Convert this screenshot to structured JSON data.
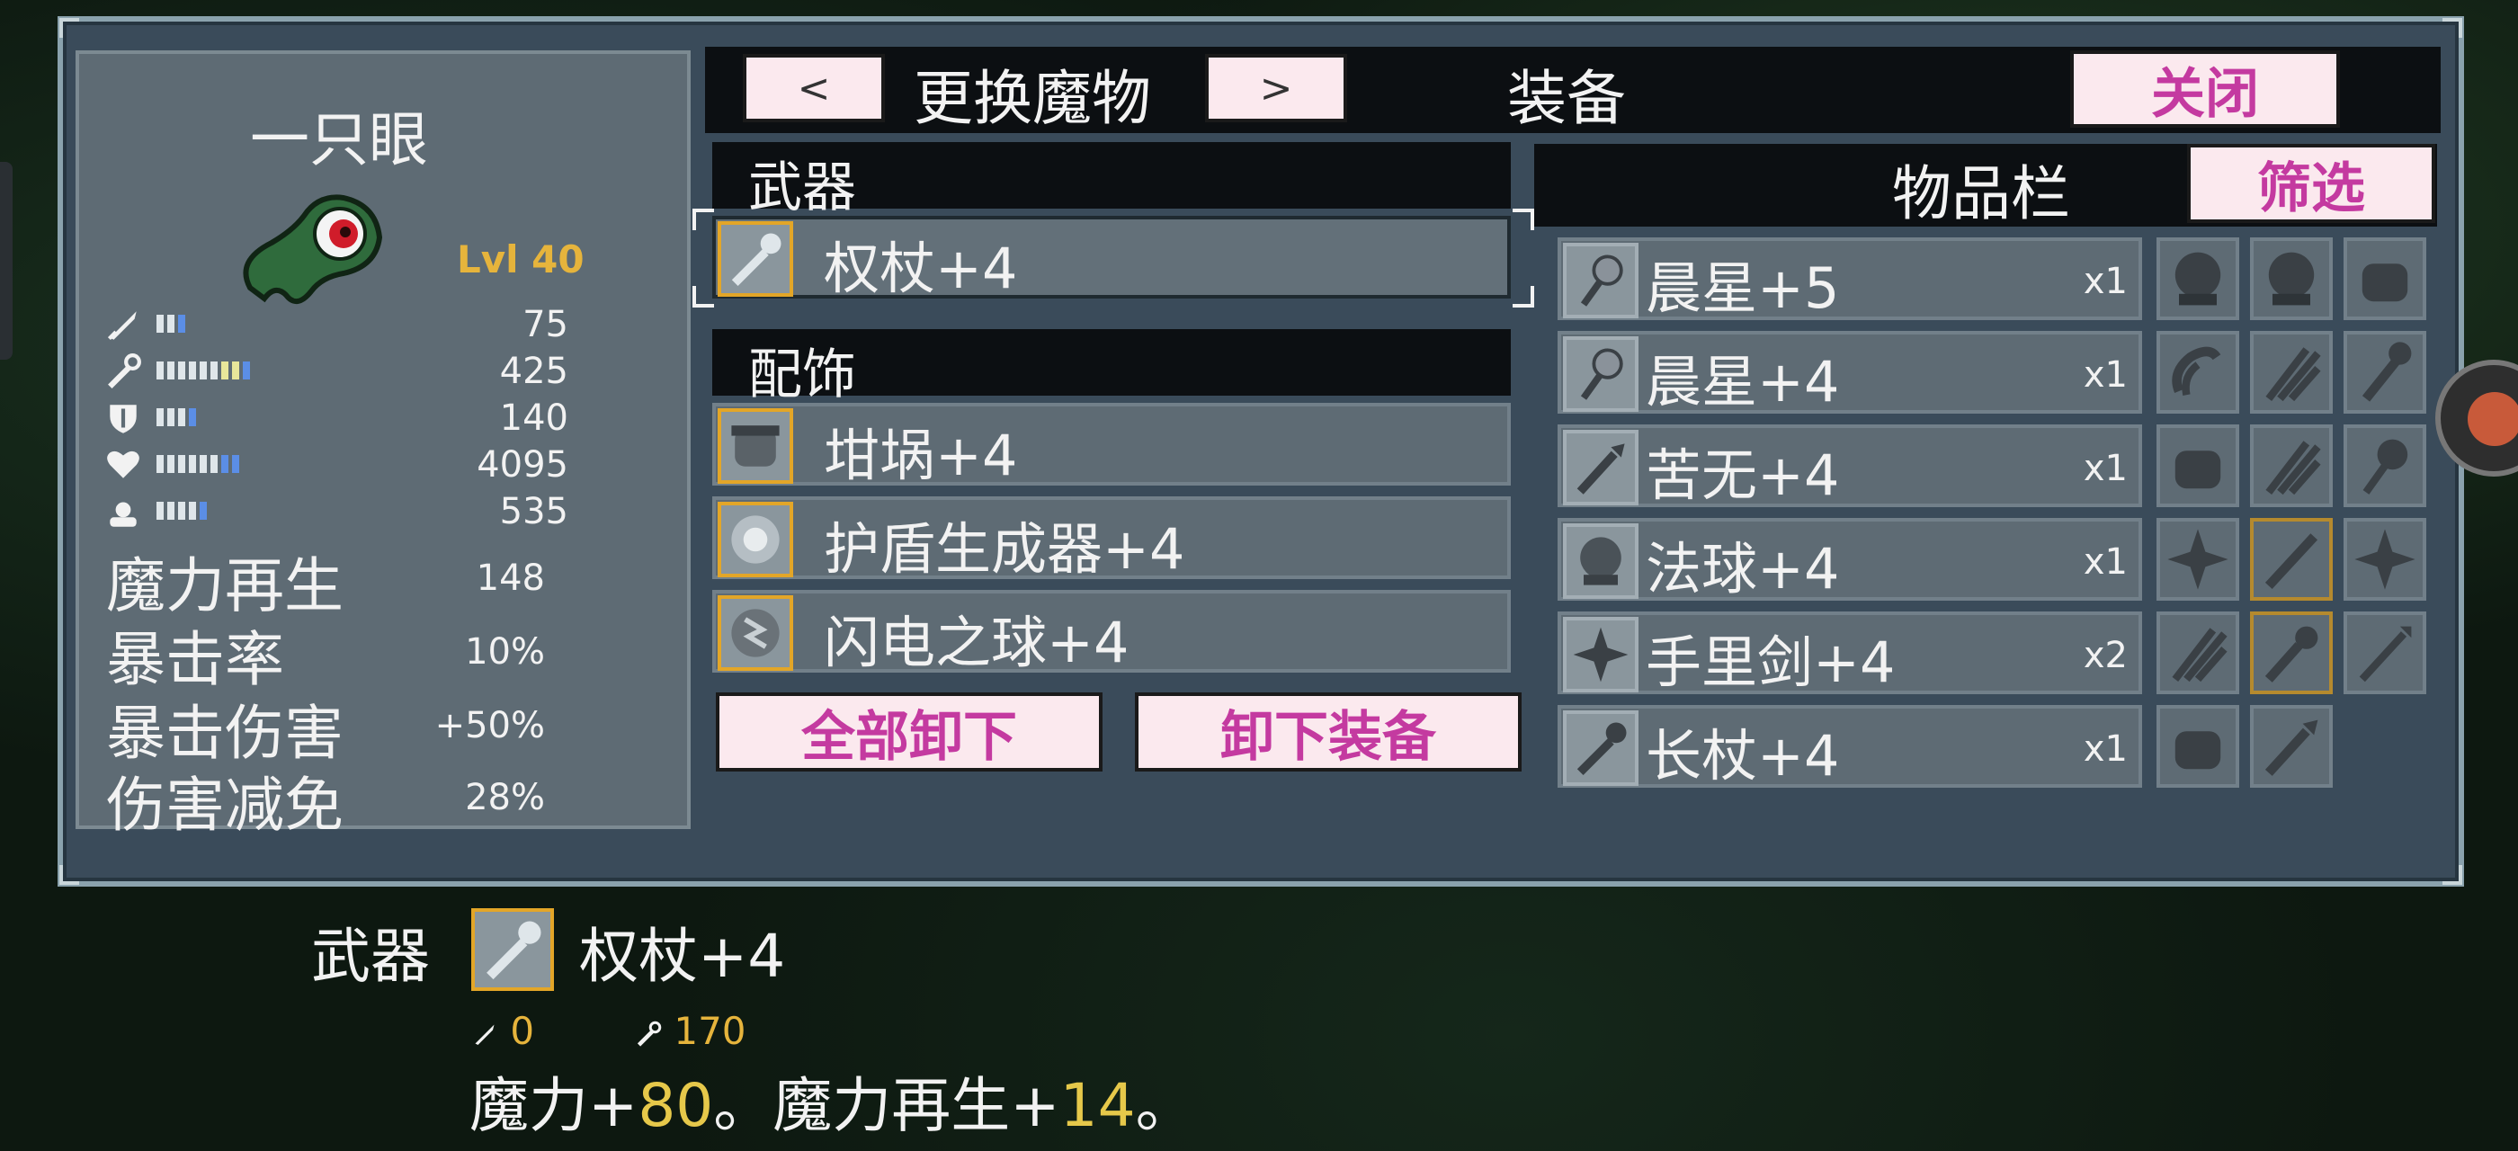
{
  "monster": {
    "name": "一只眼",
    "level": "Lvl 40",
    "stats": [
      {
        "icon": "sword-icon",
        "value": "75"
      },
      {
        "icon": "staff-icon",
        "value": "425"
      },
      {
        "icon": "shield-icon",
        "value": "140"
      },
      {
        "icon": "heart-icon",
        "value": "4095"
      },
      {
        "icon": "boot-icon",
        "value": "535"
      }
    ],
    "text_stats": [
      {
        "label": "魔力再生",
        "value": "148"
      },
      {
        "label": "暴击率",
        "value": "10%"
      },
      {
        "label": "暴击伤害",
        "value": "+50%"
      },
      {
        "label": "伤害减免",
        "value": "28%"
      }
    ]
  },
  "header": {
    "prev_label": "<",
    "change_monster": "更换魔物",
    "next_label": ">",
    "equip_title": "装备",
    "close_label": "关闭"
  },
  "weapon_section": {
    "title": "武器",
    "item": "权杖+4"
  },
  "accessory_section": {
    "title": "配饰",
    "items": [
      "坩埚+4",
      "护盾生成器+4",
      "闪电之球+4"
    ]
  },
  "buttons": {
    "unequip_all": "全部卸下",
    "unequip": "卸下装备"
  },
  "inventory": {
    "title": "物品栏",
    "filter_label": "筛选",
    "rows": [
      {
        "name": "晨星+5",
        "count": "x1",
        "icon": "morningstar-icon"
      },
      {
        "name": "晨星+4",
        "count": "x1",
        "icon": "morningstar-icon"
      },
      {
        "name": "苦无+4",
        "count": "x1",
        "icon": "kunai-icon"
      },
      {
        "name": "法球+4",
        "count": "x1",
        "icon": "orb-icon"
      },
      {
        "name": "手里剑+4",
        "count": "x2",
        "icon": "shuriken-icon"
      },
      {
        "name": "长杖+4",
        "count": "x1",
        "icon": "long-staff-icon"
      }
    ]
  },
  "detail": {
    "category": "武器",
    "name": "权杖+4",
    "attack": "0",
    "magic": "170",
    "desc_a": "魔力+",
    "desc_a_num": "80",
    "desc_b": "。魔力再生+",
    "desc_b_num": "14",
    "desc_c": "。"
  },
  "colors": {
    "panel": "#5e6b74",
    "dialog": "#3a4b5a",
    "gold": "#e6b43c",
    "pink_button": "#fbe9ee",
    "pink_text": "#c43aa0"
  }
}
